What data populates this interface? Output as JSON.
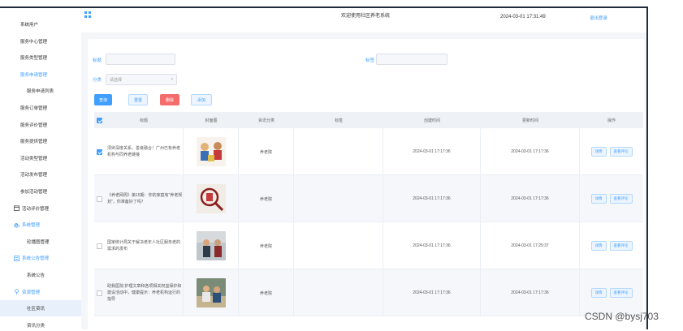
{
  "app": {
    "title": "欢迎使用社区养老系统",
    "datetime": "2024-03-01 17:31:49",
    "user_link": "退出登录"
  },
  "sidebar": {
    "items": [
      {
        "label": "系统用户",
        "type": "top"
      },
      {
        "label": "服务中心管理",
        "type": "top"
      },
      {
        "label": "服务类型管理",
        "type": "top"
      },
      {
        "label": "服务申请管理",
        "type": "active-parent"
      },
      {
        "label": "服务申请列表",
        "type": "sub"
      },
      {
        "label": "服务订单管理",
        "type": "top"
      },
      {
        "label": "服务评价管理",
        "type": "top"
      },
      {
        "label": "服务提供管理",
        "type": "top"
      },
      {
        "label": "活动类型管理",
        "type": "top"
      },
      {
        "label": "活动发布管理",
        "type": "top"
      },
      {
        "label": "参加活动管理",
        "type": "top"
      },
      {
        "label": "活动评价管理",
        "type": "icon",
        "icon": "calendar-icon"
      },
      {
        "label": "系统管理",
        "type": "icon-active",
        "icon": "cloud-icon"
      },
      {
        "label": "轮播图管理",
        "type": "sub"
      },
      {
        "label": "系统公告管理",
        "type": "icon-active",
        "icon": "notice-icon"
      },
      {
        "label": "系统公告",
        "type": "sub"
      },
      {
        "label": "资源管理",
        "type": "icon-active",
        "icon": "location-icon"
      },
      {
        "label": "社区资讯",
        "type": "sub-selected"
      },
      {
        "label": "资讯分类",
        "type": "sub"
      }
    ]
  },
  "search": {
    "title_label": "标题",
    "title_placeholder": "",
    "tag_label": "标签",
    "tag_placeholder": "",
    "category_label": "分类",
    "category_placeholder": "请选择",
    "buttons": {
      "search": "查询",
      "reset": "重置",
      "delete": "删除",
      "add": "添加"
    }
  },
  "table": {
    "columns": [
      "标题",
      "封面图",
      "资讯分类",
      "标签",
      "创建时间",
      "更新时间",
      "操作"
    ],
    "rows": [
      {
        "checked": true,
        "title": "须臾深度关系，善良融合！广州已有养老机构与同养老链接",
        "category": "养老院",
        "tag": "",
        "created": "2024-03-01 17:17:36",
        "updated": "2024-03-01 17:17:36",
        "actions": [
          "详情",
          "查看评论"
        ]
      },
      {
        "checked": false,
        "title": "《养老网周》第15期：你的家庭有\"养老规划\"，你准备好了吗？",
        "category": "养老院",
        "tag": "",
        "created": "2024-03-01 17:17:36",
        "updated": "2024-03-01 17:17:36",
        "actions": [
          "详情",
          "查看评论"
        ]
      },
      {
        "checked": false,
        "title": "国家统计局关于解决老年人社区服务老的需求的发布",
        "category": "养老院",
        "tag": "",
        "created": "2024-03-01 17:17:36",
        "updated": "2024-03-01 17:25:37",
        "actions": [
          "详情",
          "查看评论"
        ]
      },
      {
        "checked": false,
        "title": "助我医院:护理文章和各项相关权益保护和建设活动中，健康提示：养老机构运行的指导",
        "category": "养老院",
        "tag": "",
        "created": "2024-03-01 17:17:36",
        "updated": "2024-03-01 17:17:36",
        "actions": [
          "详情",
          "查看评论"
        ]
      }
    ]
  },
  "watermark": "CSDN @bysj703",
  "colors": {
    "accent": "#409eff",
    "danger": "#f56c6c",
    "header_bg": "#eef1f6"
  }
}
